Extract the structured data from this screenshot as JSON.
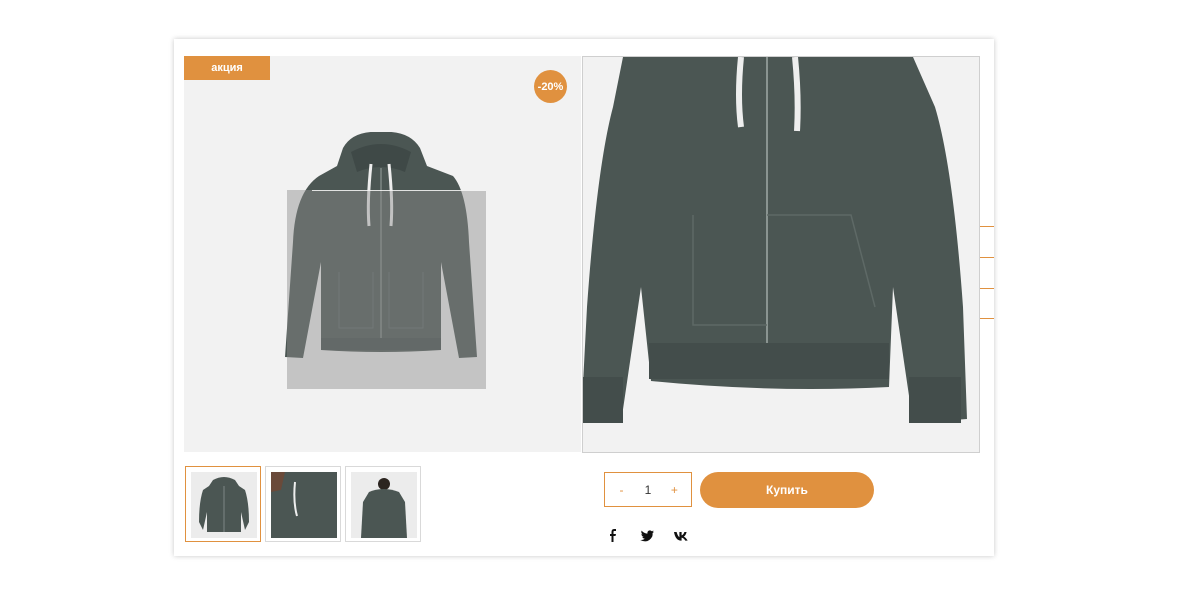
{
  "product": {
    "sale_label": "акция",
    "discount_label": "-20%",
    "quantity": "1",
    "decrement_label": "-",
    "increment_label": "+",
    "buy_label": "Купить"
  },
  "gallery": {
    "thumbnails": [
      {
        "name": "hoodie-front",
        "active": true
      },
      {
        "name": "hoodie-model-side",
        "active": false
      },
      {
        "name": "hoodie-model-back",
        "active": false
      }
    ]
  },
  "share": [
    "facebook-icon",
    "twitter-icon",
    "vk-icon"
  ],
  "colors": {
    "accent": "#e0913f",
    "hoodie": "#4b5653",
    "background": "#f2f2f2"
  }
}
